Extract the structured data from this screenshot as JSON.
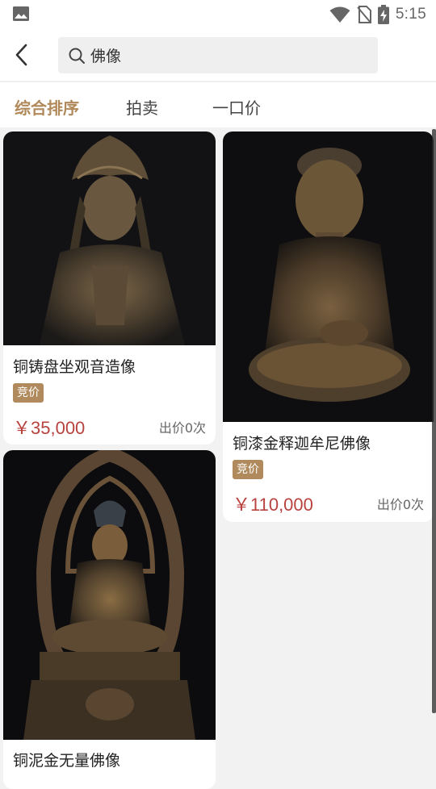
{
  "status_bar": {
    "time": "5:15"
  },
  "search": {
    "query": "佛像"
  },
  "tabs": [
    {
      "label": "综合排序",
      "active": true
    },
    {
      "label": "拍卖",
      "active": false
    },
    {
      "label": "一口价",
      "active": false
    }
  ],
  "products": [
    {
      "title": "铜铸盘坐观音造像",
      "badge": "竞价",
      "price": "￥35,000",
      "bids": "出价0次"
    },
    {
      "title": "铜漆金释迦牟尼佛像",
      "badge": "竞价",
      "price": "￥110,000",
      "bids": "出价0次"
    },
    {
      "title": "铜泥金无量佛像"
    }
  ],
  "colors": {
    "accent": "#b0885a",
    "price": "#b8423e",
    "badge_bg": "#b08a5c"
  }
}
